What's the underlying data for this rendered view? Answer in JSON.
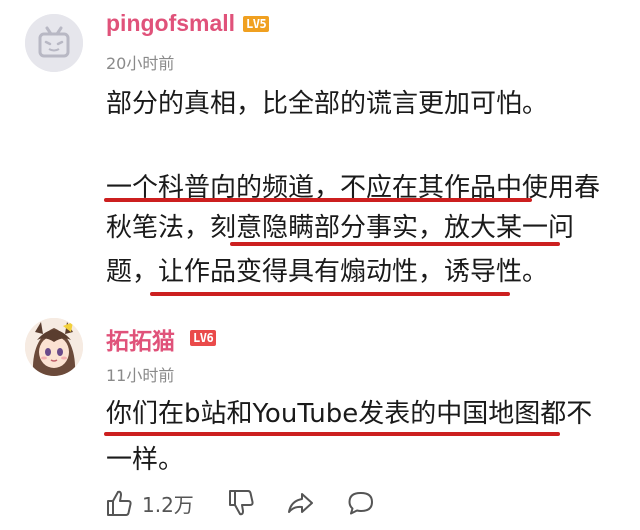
{
  "comments": [
    {
      "username": "pingofsmall",
      "level": "LV5",
      "time": "20小时前",
      "paragraphs": [
        "部分的真相，比全部的谎言更加可怕。",
        "一个科普向的频道，不应在其作品中使用春",
        "秋笔法，刻意隐瞒部分事实，放大某一问",
        "题，让作品变得具有煽动性，诱导性。"
      ]
    },
    {
      "username": "拓拓猫",
      "level": "LV6",
      "time": "11小时前",
      "paragraphs": [
        "你们在b站和YouTube发表的中国地图都不",
        "一样。"
      ]
    }
  ],
  "actions": {
    "like_count": "1.2万"
  },
  "colors": {
    "username": "#e0527a",
    "level_lv5": "#f0a020",
    "level_lv6": "#ea4a4a",
    "underline": "#cc1f1f"
  }
}
